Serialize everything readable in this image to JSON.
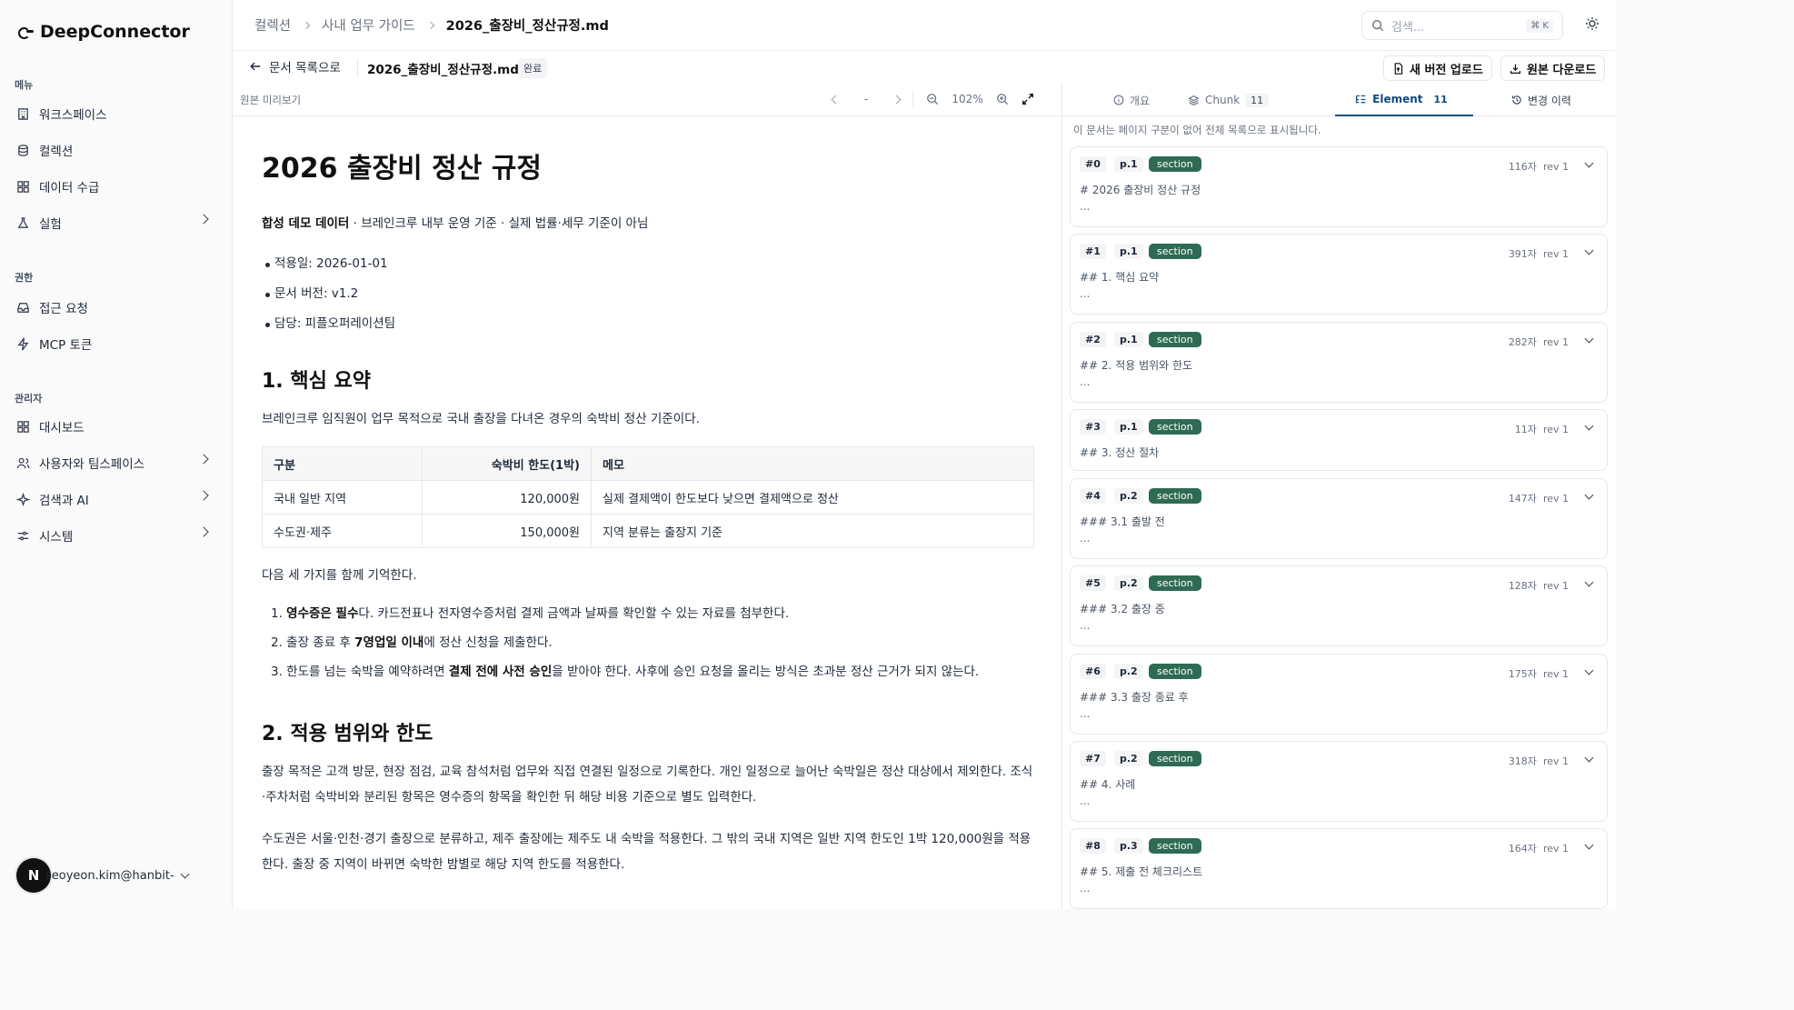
{
  "app": {
    "brand": "DeepConnector"
  },
  "sidebar": {
    "groups": [
      {
        "label": "메뉴",
        "items": [
          {
            "label": "워크스페이스",
            "icon": "building-icon"
          },
          {
            "label": "컬렉션",
            "icon": "database-icon"
          },
          {
            "label": "데이터 수급",
            "icon": "grid-icon"
          },
          {
            "label": "실험",
            "icon": "flask-icon",
            "has_children": true
          }
        ]
      },
      {
        "label": "권한",
        "items": [
          {
            "label": "접근 요청",
            "icon": "inbox-icon"
          },
          {
            "label": "MCP 토큰",
            "icon": "bolt-icon"
          }
        ]
      },
      {
        "label": "관리자",
        "items": [
          {
            "label": "대시보드",
            "icon": "grid-icon"
          },
          {
            "label": "사용자와 팀스페이스",
            "icon": "users-icon",
            "has_children": true
          },
          {
            "label": "검색과 AI",
            "icon": "sparkle-icon",
            "has_children": true
          },
          {
            "label": "시스템",
            "icon": "settings-icon",
            "has_children": true
          }
        ]
      }
    ],
    "user": {
      "avatar_letter": "N",
      "email": "seoyeon.kim@hanbit-de..."
    }
  },
  "header": {
    "breadcrumb": [
      "컬렉션",
      "사내 업무 가이드",
      "2026_출장비_정산규정.md"
    ],
    "search": {
      "placeholder": "검색...",
      "shortcut": "⌘ K"
    }
  },
  "docbar": {
    "back_label": "문서 목록으로",
    "doc_name": "2026_출장비_정산규정.md",
    "status": "완료",
    "upload_label": "새 버전 업로드",
    "download_label": "원본 다운로드"
  },
  "viewer": {
    "label": "원본 미리보기",
    "page_indicator": "-",
    "zoom": "102%"
  },
  "document": {
    "title": "2026 출장비 정산 규정",
    "subtitle_bold": "합성 데모 데이터",
    "subtitle_rest": " · 브레인크루 내부 운영 기준 · 실제 법률·세무 기준이 아님",
    "meta": [
      "적용일: 2026-01-01",
      "문서 버전: v1.2",
      "담당: 피플오퍼레이션팀"
    ],
    "s1_title": "1. 핵심 요약",
    "s1_intro": "브레인크루 임직원이 업무 목적으로 국내 출장을 다녀온 경우의 숙박비 정산 기준이다.",
    "table": {
      "headers": [
        "구분",
        "숙박비 한도(1박)",
        "메모"
      ],
      "rows": [
        [
          "국내 일반 지역",
          "120,000원",
          "실제 결제액이 한도보다 낮으면 결제액으로 정산"
        ],
        [
          "수도권·제주",
          "150,000원",
          "지역 분류는 출장지 기준"
        ]
      ]
    },
    "remember": "다음 세 가지를 함께 기억한다.",
    "rules": [
      {
        "pre": "1. ",
        "bold": "영수증은 필수",
        "post": "다. 카드전표나 전자영수증처럼 결제 금액과 날짜를 확인할 수 있는 자료를 첨부한다."
      },
      {
        "pre": "2. 출장 종료 후 ",
        "bold": "7영업일 이내",
        "post": "에 정산 신청을 제출한다."
      },
      {
        "pre": "3. 한도를 넘는 숙박을 예약하려면 ",
        "bold": "결제 전에 사전 승인",
        "post": "을 받아야 한다. 사후에 승인 요청을 올리는 방식은 초과분 정산 근거가 되지 않는다."
      }
    ],
    "s2_title": "2. 적용 범위와 한도",
    "s2_p1": "출장 목적은 고객 방문, 현장 점검, 교육 참석처럼 업무와 직접 연결된 일정으로 기록한다. 개인 일정으로 늘어난 숙박일은 정산 대상에서 제외한다. 조식·주차처럼 숙박비와 분리된 항목은 영수증의 항목을 확인한 뒤 해당 비용 기준으로 별도 입력한다.",
    "s2_p2": "수도권은 서울·인천·경기 출장으로 분류하고, 제주 출장에는 제주도 내 숙박을 적용한다. 그 밖의 국내 지역은 일반 지역 한도인 1박 120,000원을 적용한다. 출장 중 지역이 바뀌면 숙박한 밤별로 해당 지역 한도를 적용한다."
  },
  "panel": {
    "tabs": [
      {
        "label": "개요",
        "count": ""
      },
      {
        "label": "Chunk",
        "count": "11"
      },
      {
        "label": "Element",
        "count": "11"
      },
      {
        "label": "변경 이력",
        "count": ""
      }
    ],
    "active_tab": "Element",
    "notice": "이 문서는 페이지 구분이 없어 전체 목록으로 표시됩니다.",
    "elements": [
      {
        "idx": "#0",
        "page": "p.1",
        "type": "section",
        "chars": "116자",
        "rev": "rev 1",
        "text": "# 2026 출장비 정산 규정",
        "more": "..."
      },
      {
        "idx": "#1",
        "page": "p.1",
        "type": "section",
        "chars": "391자",
        "rev": "rev 1",
        "text": "## 1. 핵심 요약",
        "more": "..."
      },
      {
        "idx": "#2",
        "page": "p.1",
        "type": "section",
        "chars": "282자",
        "rev": "rev 1",
        "text": "## 2. 적용 범위와 한도",
        "more": "..."
      },
      {
        "idx": "#3",
        "page": "p.1",
        "type": "section",
        "chars": "11자",
        "rev": "rev 1",
        "text": "## 3. 정산 절차",
        "more": ""
      },
      {
        "idx": "#4",
        "page": "p.2",
        "type": "section",
        "chars": "147자",
        "rev": "rev 1",
        "text": "### 3.1 출발 전",
        "more": "..."
      },
      {
        "idx": "#5",
        "page": "p.2",
        "type": "section",
        "chars": "128자",
        "rev": "rev 1",
        "text": "### 3.2 출장 중",
        "more": "..."
      },
      {
        "idx": "#6",
        "page": "p.2",
        "type": "section",
        "chars": "175자",
        "rev": "rev 1",
        "text": "### 3.3 출장 종료 후",
        "more": "..."
      },
      {
        "idx": "#7",
        "page": "p.2",
        "type": "section",
        "chars": "318자",
        "rev": "rev 1",
        "text": "## 4. 사례",
        "more": "..."
      },
      {
        "idx": "#8",
        "page": "p.3",
        "type": "section",
        "chars": "164자",
        "rev": "rev 1",
        "text": "## 5. 제출 전 체크리스트",
        "more": "..."
      }
    ]
  }
}
